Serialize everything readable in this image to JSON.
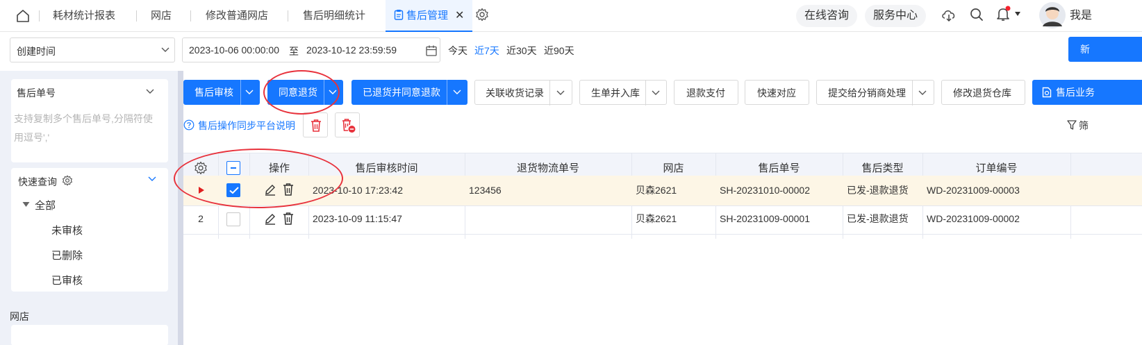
{
  "tabs": [
    {
      "label": "耗材统计报表"
    },
    {
      "label": "网店"
    },
    {
      "label": "修改普通网店"
    },
    {
      "label": "售后明细统计"
    },
    {
      "label": "售后管理",
      "active": true
    }
  ],
  "header": {
    "online_consult": "在线咨询",
    "service_center": "服务中心",
    "user_name": "我是"
  },
  "filter": {
    "date_field": "创建时间",
    "start": "2023-10-06 00:00:00",
    "to": "至",
    "end": "2023-10-12 23:59:59",
    "ranges": [
      {
        "label": "今天"
      },
      {
        "label": "近7天",
        "active": true
      },
      {
        "label": "近30天"
      },
      {
        "label": "近90天"
      }
    ],
    "new_button": "新"
  },
  "left": {
    "order_no_title": "售后单号",
    "order_no_placeholder": "支持复制多个售后单号,分隔符使用逗号','",
    "quick_query_title": "快速查询",
    "tree_root": "全部",
    "tree_items": [
      "未审核",
      "已删除",
      "已审核"
    ],
    "shop_title": "网店"
  },
  "toolbar": {
    "audit": "售后审核",
    "agree_return": "同意退货",
    "returned_refund": "已退货并同意退款",
    "link_receipt": "关联收货记录",
    "gen_inbound": "生单并入库",
    "refund_pay": "退款支付",
    "quick_match": "快速对应",
    "submit_distributor": "提交给分销商处理",
    "modify_warehouse": "修改退货仓库",
    "aftersale_business": "售后业务",
    "sync_note": "售后操作同步平台说明",
    "filter": "筛"
  },
  "table": {
    "columns": [
      "操作",
      "售后审核时间",
      "退货物流单号",
      "网店",
      "售后单号",
      "售后类型",
      "订单编号"
    ],
    "rows": [
      {
        "index": "",
        "selected": true,
        "audit_time": "2023-10-10 17:23:42",
        "tracking_no": "123456",
        "shop": "贝森2621",
        "aftersale_no": "SH-20231010-00002",
        "type": "已发-退款退货",
        "order_no": "WD-20231009-00003"
      },
      {
        "index": "2",
        "selected": false,
        "audit_time": "2023-10-09 11:15:47",
        "tracking_no": "",
        "shop": "贝森2621",
        "aftersale_no": "SH-20231009-00001",
        "type": "已发-退款退货",
        "order_no": "WD-20231009-00002"
      }
    ]
  },
  "colors": {
    "primary": "#1677ff",
    "selected_row": "#fdf6e6",
    "annotation": "#e8323c",
    "row_marker": "#e02020",
    "notification_dot": "#f5222d"
  }
}
